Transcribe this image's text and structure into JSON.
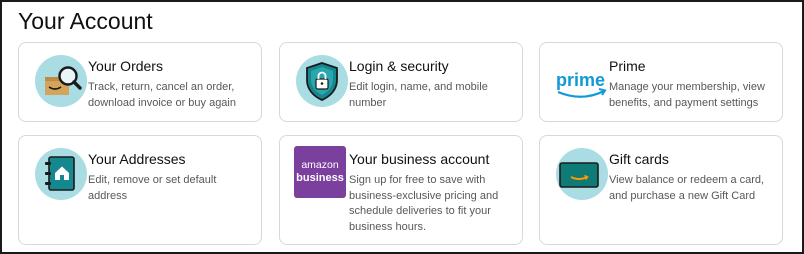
{
  "page": {
    "title": "Your Account"
  },
  "cards": [
    {
      "title": "Your Orders",
      "description": "Track, return, cancel an order, download invoice or buy again",
      "icon": "orders-magnifier-box-icon"
    },
    {
      "title": "Login & security",
      "description": "Edit login, name, and mobile number",
      "icon": "shield-lock-icon"
    },
    {
      "title": "Prime",
      "description": "Manage your membership, view benefits, and payment settings",
      "icon": "prime-logo-icon",
      "logo_text": "prime"
    },
    {
      "title": "Your Addresses",
      "description": "Edit, remove or set default address",
      "icon": "address-book-home-icon"
    },
    {
      "title": "Your business account",
      "description": "Sign up for free to save with business-exclusive pricing and schedule deliveries to fit your business hours.",
      "icon": "amazon-business-logo-icon",
      "logo_line1": "amazon",
      "logo_line2": "business"
    },
    {
      "title": "Gift cards",
      "description": "View balance or redeem a card, and purchase a new Gift Card",
      "icon": "gift-card-icon"
    }
  ],
  "colors": {
    "icon_circle": "#a9dde3",
    "icon_teal": "#15888f",
    "prime_blue": "#1399d6",
    "business_purple": "#7b3f9e",
    "smile_orange": "#ff9900",
    "card_border": "#d5d9d9",
    "desc_text": "#565959"
  }
}
